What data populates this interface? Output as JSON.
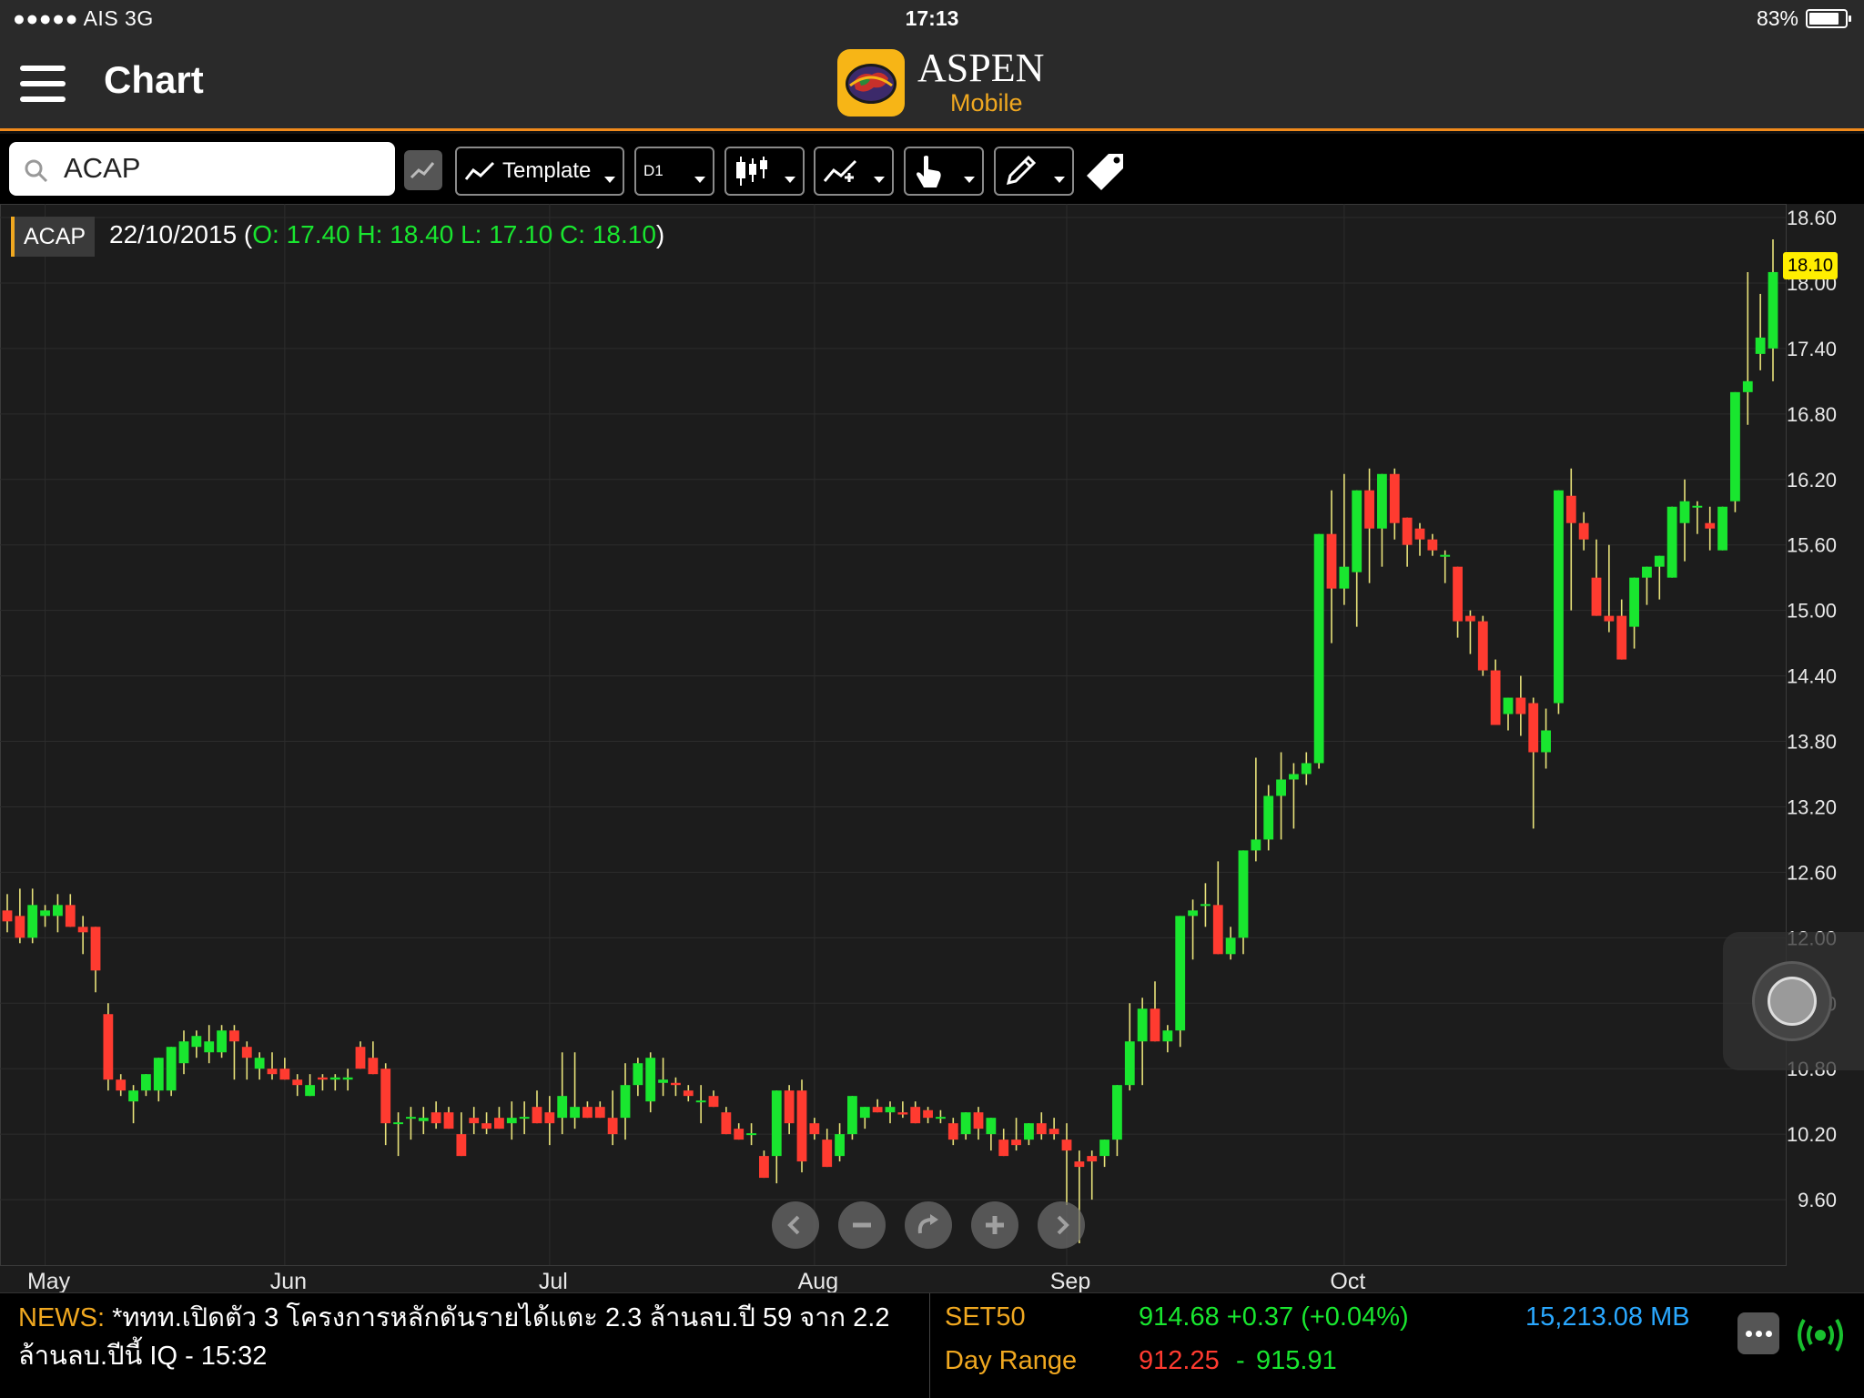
{
  "status_bar": {
    "carrier": "●●●●● AIS   3G",
    "time": "17:13",
    "battery": "83%",
    "battery_level": 0.83
  },
  "header": {
    "title": "Chart",
    "logo_title": "ASPEN",
    "logo_subtitle": "Mobile"
  },
  "toolbar": {
    "search_value": "ACAP",
    "template_label": "Template",
    "period_label": "D1",
    "icons": [
      "search-icon",
      "chart-type-icon",
      "line-template-icon",
      "candlestick-icon",
      "indicator-icon",
      "pointer-icon",
      "pencil-icon",
      "tag-icon"
    ]
  },
  "chart_header": {
    "symbol": "ACAP",
    "date": "22/10/2015",
    "paren_open": "(",
    "ohlc": "O: 17.40 H: 18.40 L: 17.10 C: 18.10",
    "paren_close": ")",
    "last_price": "18.10"
  },
  "colors": {
    "up": "#19e62f",
    "down": "#ff3b30",
    "wick": "#e8e27a",
    "accent": "#f08a1c",
    "grid": "#2c2c2c",
    "last_price_bg": "#ffee00"
  },
  "chart_data": {
    "type": "candlestick",
    "symbol": "ACAP",
    "y_axis": {
      "min": 9.0,
      "max": 18.6,
      "ticks": [
        "18.60",
        "18.00",
        "17.40",
        "16.80",
        "16.20",
        "15.60",
        "15.00",
        "14.40",
        "13.80",
        "13.20",
        "12.60",
        "12.00",
        "11.40",
        "10.80",
        "10.20",
        "9.60"
      ]
    },
    "x_axis": {
      "labels": [
        "May",
        "Jun",
        "Jul",
        "Aug",
        "Sep",
        "Oct"
      ],
      "label_index": [
        3,
        22,
        43,
        64,
        84,
        106
      ]
    },
    "grid": true,
    "ohlc": [
      [
        12.25,
        12.4,
        12.05,
        12.15
      ],
      [
        12.2,
        12.45,
        11.95,
        12.0
      ],
      [
        12.0,
        12.45,
        11.95,
        12.3
      ],
      [
        12.2,
        12.3,
        12.1,
        12.25
      ],
      [
        12.2,
        12.4,
        12.05,
        12.3
      ],
      [
        12.3,
        12.4,
        12.1,
        12.1
      ],
      [
        12.1,
        12.2,
        11.85,
        12.05
      ],
      [
        12.1,
        12.1,
        11.5,
        11.7
      ],
      [
        11.3,
        11.4,
        10.6,
        10.7
      ],
      [
        10.7,
        10.75,
        10.55,
        10.6
      ],
      [
        10.5,
        10.65,
        10.3,
        10.6
      ],
      [
        10.6,
        10.7,
        10.55,
        10.75
      ],
      [
        10.6,
        10.9,
        10.5,
        10.9
      ],
      [
        10.6,
        11.0,
        10.55,
        11.0
      ],
      [
        10.85,
        11.15,
        10.75,
        11.05
      ],
      [
        11.0,
        11.15,
        10.9,
        11.1
      ],
      [
        10.95,
        11.2,
        10.85,
        11.05
      ],
      [
        10.95,
        11.2,
        10.9,
        11.15
      ],
      [
        11.15,
        11.2,
        10.7,
        11.05
      ],
      [
        11.0,
        11.05,
        10.7,
        10.9
      ],
      [
        10.8,
        10.95,
        10.7,
        10.9
      ],
      [
        10.8,
        10.95,
        10.7,
        10.75
      ],
      [
        10.8,
        10.9,
        10.7,
        10.7
      ],
      [
        10.7,
        10.75,
        10.55,
        10.65
      ],
      [
        10.55,
        10.75,
        10.55,
        10.65
      ],
      [
        10.72,
        10.75,
        10.6,
        10.7
      ],
      [
        10.7,
        10.75,
        10.6,
        10.72
      ],
      [
        10.7,
        10.8,
        10.6,
        10.72
      ],
      [
        11.0,
        11.05,
        10.8,
        10.8
      ],
      [
        10.9,
        11.05,
        10.75,
        10.75
      ],
      [
        10.8,
        10.85,
        10.1,
        10.3
      ],
      [
        10.3,
        10.4,
        10.0,
        10.3
      ],
      [
        10.35,
        10.45,
        10.15,
        10.35
      ],
      [
        10.32,
        10.45,
        10.2,
        10.35
      ],
      [
        10.4,
        10.5,
        10.25,
        10.3
      ],
      [
        10.4,
        10.45,
        10.25,
        10.25
      ],
      [
        10.2,
        10.4,
        10.0,
        10.0
      ],
      [
        10.35,
        10.45,
        10.2,
        10.3
      ],
      [
        10.3,
        10.4,
        10.2,
        10.25
      ],
      [
        10.35,
        10.45,
        10.25,
        10.25
      ],
      [
        10.3,
        10.5,
        10.15,
        10.35
      ],
      [
        10.35,
        10.5,
        10.2,
        10.35
      ],
      [
        10.45,
        10.6,
        10.3,
        10.3
      ],
      [
        10.4,
        10.55,
        10.1,
        10.3
      ],
      [
        10.35,
        10.95,
        10.2,
        10.55
      ],
      [
        10.35,
        10.95,
        10.25,
        10.45
      ],
      [
        10.45,
        10.5,
        10.35,
        10.35
      ],
      [
        10.45,
        10.5,
        10.35,
        10.35
      ],
      [
        10.35,
        10.6,
        10.1,
        10.2
      ],
      [
        10.35,
        10.85,
        10.15,
        10.65
      ],
      [
        10.65,
        10.9,
        10.55,
        10.85
      ],
      [
        10.5,
        10.95,
        10.4,
        10.9
      ],
      [
        10.67,
        10.9,
        10.55,
        10.7
      ],
      [
        10.67,
        10.72,
        10.55,
        10.65
      ],
      [
        10.6,
        10.65,
        10.5,
        10.55
      ],
      [
        10.5,
        10.65,
        10.3,
        10.5
      ],
      [
        10.55,
        10.6,
        10.45,
        10.45
      ],
      [
        10.4,
        10.45,
        10.2,
        10.2
      ],
      [
        10.25,
        10.3,
        10.15,
        10.15
      ],
      [
        10.2,
        10.3,
        10.1,
        10.2
      ],
      [
        10.0,
        10.05,
        9.85,
        9.8
      ],
      [
        10.0,
        10.2,
        9.75,
        10.6
      ],
      [
        10.6,
        10.65,
        10.2,
        10.3
      ],
      [
        10.6,
        10.7,
        9.85,
        9.95
      ],
      [
        10.3,
        10.35,
        10.15,
        10.2
      ],
      [
        10.15,
        10.25,
        9.95,
        9.9
      ],
      [
        10.0,
        10.3,
        9.95,
        10.2
      ],
      [
        10.2,
        10.55,
        10.15,
        10.55
      ],
      [
        10.35,
        10.45,
        10.25,
        10.45
      ],
      [
        10.45,
        10.52,
        10.4,
        10.4
      ],
      [
        10.4,
        10.5,
        10.3,
        10.45
      ],
      [
        10.4,
        10.5,
        10.35,
        10.38
      ],
      [
        10.45,
        10.5,
        10.3,
        10.3
      ],
      [
        10.42,
        10.45,
        10.3,
        10.35
      ],
      [
        10.35,
        10.42,
        10.3,
        10.35
      ],
      [
        10.3,
        10.35,
        10.1,
        10.15
      ],
      [
        10.2,
        10.4,
        10.15,
        10.4
      ],
      [
        10.4,
        10.45,
        10.15,
        10.25
      ],
      [
        10.2,
        10.35,
        10.05,
        10.35
      ],
      [
        10.15,
        10.25,
        10.0,
        10.0
      ],
      [
        10.15,
        10.35,
        10.05,
        10.1
      ],
      [
        10.15,
        10.3,
        10.1,
        10.3
      ],
      [
        10.3,
        10.4,
        10.15,
        10.2
      ],
      [
        10.25,
        10.35,
        10.15,
        10.2
      ],
      [
        10.15,
        10.3,
        9.55,
        10.05
      ],
      [
        9.95,
        10.05,
        9.2,
        9.9
      ],
      [
        10.0,
        10.05,
        9.6,
        9.95
      ],
      [
        10.0,
        10.1,
        9.9,
        10.15
      ],
      [
        10.15,
        10.5,
        10.0,
        10.65
      ],
      [
        10.65,
        11.4,
        10.6,
        11.05
      ],
      [
        11.05,
        11.45,
        10.65,
        11.35
      ],
      [
        11.35,
        11.6,
        11.1,
        11.05
      ],
      [
        11.05,
        11.2,
        10.95,
        11.15
      ],
      [
        11.15,
        11.35,
        11.0,
        12.2
      ],
      [
        12.2,
        12.35,
        11.8,
        12.25
      ],
      [
        12.3,
        12.5,
        12.1,
        12.3
      ],
      [
        12.3,
        12.7,
        11.85,
        11.85
      ],
      [
        11.85,
        12.1,
        11.8,
        12.0
      ],
      [
        12.0,
        12.7,
        11.85,
        12.8
      ],
      [
        12.8,
        13.65,
        12.7,
        12.9
      ],
      [
        12.9,
        13.4,
        12.8,
        13.3
      ],
      [
        13.3,
        13.7,
        12.9,
        13.45
      ],
      [
        13.45,
        13.6,
        13.0,
        13.5
      ],
      [
        13.5,
        13.7,
        13.4,
        13.6
      ],
      [
        13.6,
        14.1,
        13.55,
        15.7
      ],
      [
        15.7,
        16.1,
        14.7,
        15.2
      ],
      [
        15.2,
        16.25,
        15.05,
        15.4
      ],
      [
        15.35,
        15.65,
        14.85,
        16.1
      ],
      [
        16.1,
        16.3,
        15.25,
        15.75
      ],
      [
        15.75,
        16.2,
        15.4,
        16.25
      ],
      [
        16.25,
        16.3,
        15.65,
        15.8
      ],
      [
        15.85,
        15.7,
        15.4,
        15.6
      ],
      [
        15.75,
        15.8,
        15.5,
        15.65
      ],
      [
        15.65,
        15.7,
        15.5,
        15.55
      ],
      [
        15.5,
        15.55,
        15.25,
        15.5
      ],
      [
        15.4,
        15.3,
        14.75,
        14.9
      ],
      [
        14.95,
        15.0,
        14.6,
        14.9
      ],
      [
        14.9,
        14.95,
        14.4,
        14.45
      ],
      [
        14.45,
        14.55,
        14.0,
        13.95
      ],
      [
        14.05,
        14.15,
        13.9,
        14.2
      ],
      [
        14.2,
        14.4,
        13.85,
        14.05
      ],
      [
        14.15,
        14.2,
        13.0,
        13.7
      ],
      [
        13.7,
        14.1,
        13.55,
        13.9
      ],
      [
        14.15,
        16.1,
        14.05,
        16.1
      ],
      [
        16.05,
        16.3,
        15.0,
        15.8
      ],
      [
        15.8,
        15.9,
        15.55,
        15.65
      ],
      [
        15.3,
        15.65,
        15.05,
        14.95
      ],
      [
        14.95,
        15.6,
        14.8,
        14.9
      ],
      [
        14.95,
        15.1,
        14.55,
        14.55
      ],
      [
        14.85,
        15.05,
        14.65,
        15.3
      ],
      [
        15.3,
        15.4,
        15.05,
        15.4
      ],
      [
        15.4,
        15.5,
        15.1,
        15.5
      ],
      [
        15.3,
        15.75,
        15.35,
        15.95
      ],
      [
        15.8,
        16.2,
        15.45,
        16.0
      ],
      [
        15.95,
        16.0,
        15.7,
        15.95
      ],
      [
        15.8,
        15.95,
        15.55,
        15.75
      ],
      [
        15.55,
        15.8,
        15.55,
        15.95
      ],
      [
        16.0,
        16.6,
        15.9,
        17.0
      ],
      [
        17.0,
        18.1,
        16.7,
        17.1
      ],
      [
        17.35,
        17.9,
        17.2,
        17.5
      ],
      [
        17.4,
        18.4,
        17.1,
        18.1
      ]
    ]
  },
  "chart_controls": {
    "icons": [
      "scroll-left-icon",
      "zoom-out-icon",
      "reset-icon",
      "zoom-in-icon",
      "scroll-right-icon"
    ]
  },
  "footer": {
    "news_label": "NEWS:",
    "news_text": " *ททท.เปิดตัว 3 โครงการหลักดันรายได้แตะ 2.3 ล้านลบ.ปี 59 จาก 2.2 ล้านลบ.ปีนี้ IQ - 15:32",
    "index_label": "SET50",
    "index_value": "914.68 +0.37 (+0.04%)",
    "volume": "15,213.08 MB",
    "range_label": "Day Range",
    "range_low": "912.25",
    "range_dash": "-",
    "range_high": "915.91"
  }
}
